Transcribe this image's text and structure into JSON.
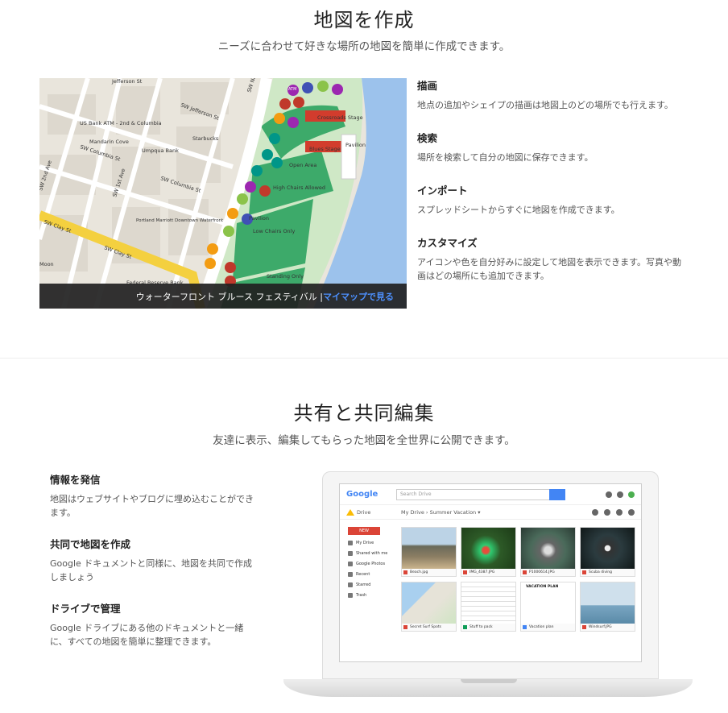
{
  "section1": {
    "title": "地図を作成",
    "subtitle": "ニーズに合わせて好きな場所の地図を簡単に作成できます。",
    "map": {
      "streets": [
        "Jefferson St",
        "SW Jefferson St",
        "SW Naito",
        "SW 2nd Ave",
        "SW 1st Ave",
        "SW Columbia St",
        "SW Clay St"
      ],
      "places": [
        "US Bank ATM - 2nd & Columbia",
        "Mandarin Cove",
        "Umpqua Bank",
        "Starbucks",
        "Portland Marriott Downtown Waterfront",
        "Federal Reserve Bank",
        "Moon"
      ],
      "venues": [
        "Crossroads Stage",
        "Blues Stage",
        "Pavilion",
        "Open Area",
        "High Chairs Allowed",
        "Low Chairs Only",
        "Standing Only"
      ],
      "atm_badge": "ATM"
    },
    "caption_text": "ウォーターフロント ブルース フェスティバル | ",
    "caption_link": "マイマップで見る",
    "features": [
      {
        "heading": "描画",
        "text": "地点の追加やシェイプの描画は地図上のどの場所でも行えます。"
      },
      {
        "heading": "検索",
        "text": "場所を検索して自分の地図に保存できます。"
      },
      {
        "heading": "インポート",
        "text": "スプレッドシートからすぐに地図を作成できます。"
      },
      {
        "heading": "カスタマイズ",
        "text": "アイコンや色を自分好みに設定して地図を表示できます。写真や動画はどの場所にも追加できます。"
      }
    ]
  },
  "section2": {
    "title": "共有と共同編集",
    "subtitle": "友達に表示、編集してもらった地図を全世界に公開できます。",
    "features": [
      {
        "heading": "情報を発信",
        "text": "地図はウェブサイトやブログに埋め込むことができます。"
      },
      {
        "heading": "共同で地図を作成",
        "text": "Google ドキュメントと同様に、地図を共同で作成しましょう"
      },
      {
        "heading": "ドライブで管理",
        "text": "Google ドライブにある他のドキュメントと一緒に、すべての地図を簡単に整理できます。"
      }
    ],
    "drive": {
      "logo": "Google",
      "search_placeholder": "Search Drive",
      "drive_label": "Drive",
      "breadcrumb": "My Drive  ›  Summer Vacation ▾",
      "new_label": "NEW",
      "sidebar": [
        "My Drive",
        "Shared with me",
        "Google Photos",
        "Recent",
        "Starred",
        "Trash"
      ],
      "files": [
        "Beach.jpg",
        "IMG_4387.JPG",
        "P1000614.JPG",
        "Scuba diving",
        "Secret Surf Spots",
        "Stuff to pack",
        "Vacation plan",
        "Windsurf.JPG"
      ],
      "doc_title": "VACATION PLAN"
    }
  },
  "colors": {
    "map_park": "#3daa6a",
    "map_water": "#9cc2ec",
    "map_road": "#ffffff",
    "map_highway": "#f4d03f",
    "link": "#4d90fe",
    "stage": "#d23c2d"
  }
}
